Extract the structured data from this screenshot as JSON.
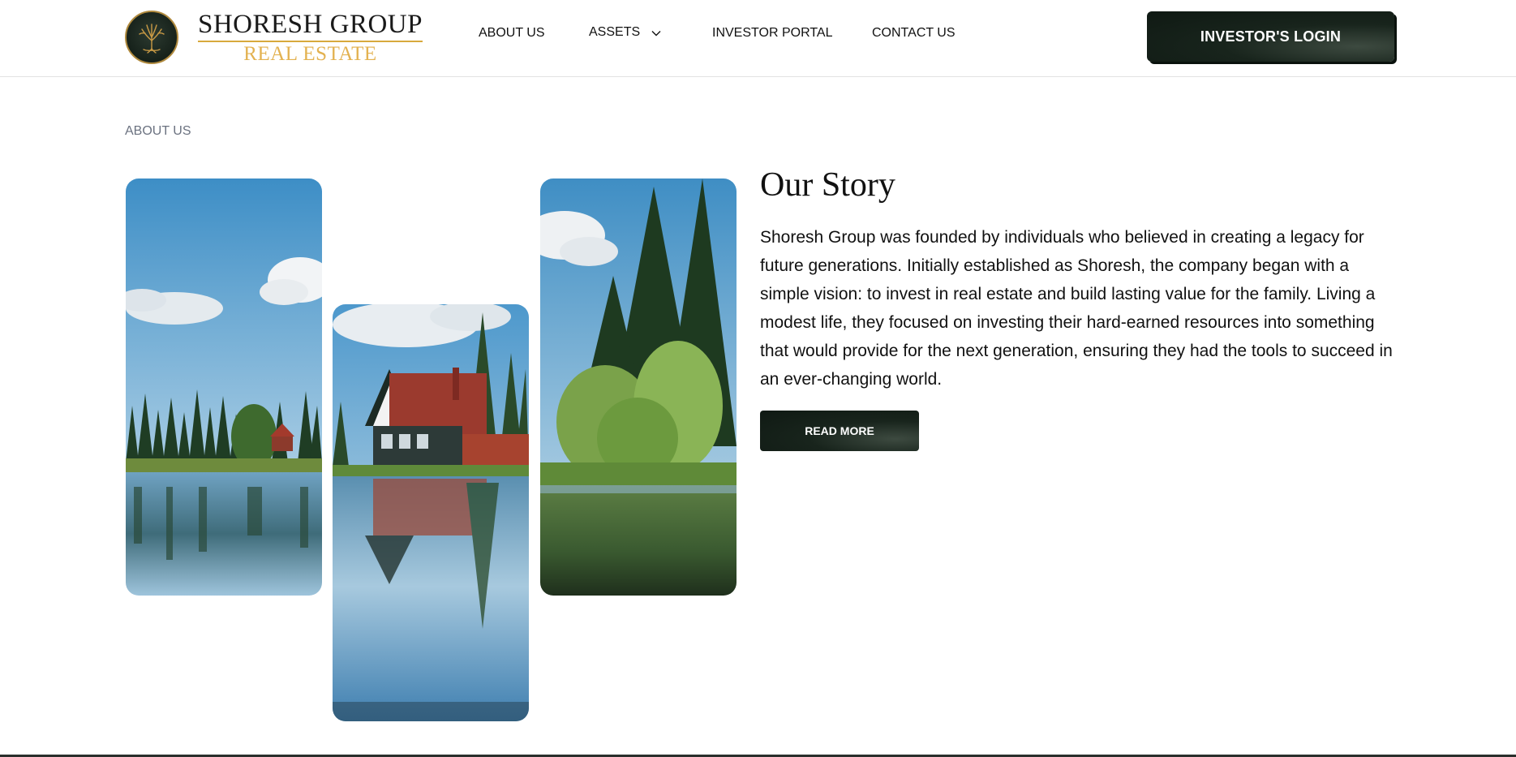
{
  "brand": {
    "line1": "SHORESH GROUP",
    "line2": "REAL ESTATE",
    "emblem_icon": "tree-of-life-icon",
    "gold": "#d8a93c"
  },
  "nav": {
    "items": [
      {
        "label": "ABOUT US"
      },
      {
        "label": "ASSETS",
        "icon": "chevron-down-icon"
      },
      {
        "label": "INVESTOR PORTAL"
      },
      {
        "label": "CONTACT US"
      }
    ],
    "login_label": "INVESTOR'S LOGIN"
  },
  "breadcrumb": "ABOUT US",
  "story": {
    "title": "Our Story",
    "body": "Shoresh Group was founded by individuals who believed in creating a legacy for future generations. Initially established as Shoresh, the company began with a simple vision: to invest in real estate and build lasting value for the family. Living a modest life, they focused on investing their hard-earned resources into something that would provide for the next generation, ensuring they had the tools to succeed in an ever-changing world.",
    "read_more_label": "READ MORE"
  },
  "colors": {
    "dark_green": "#16211a",
    "text": "#111111",
    "muted": "#6b7280"
  }
}
